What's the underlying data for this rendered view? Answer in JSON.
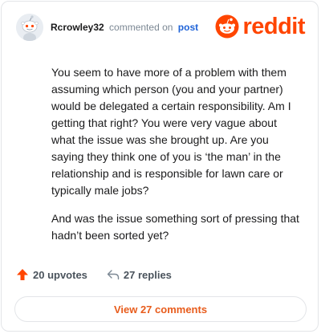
{
  "header": {
    "username": "Rcrowley32",
    "commented_text": "commented on",
    "post_link": "post",
    "brand": "reddit",
    "brand_color": "#ff4500"
  },
  "comment": {
    "paragraphs": [
      "You seem to have more of a problem with them assuming which person (you and your partner) would be delegated a certain responsibility. Am I getting that right? You were very vague about what the issue was she brought up. Are you saying they think one of you is ‘the man’ in the relationship and is responsible for lawn care or typically male jobs?",
      "And was the issue something sort of pressing that hadn’t been sorted yet?"
    ]
  },
  "actions": {
    "upvotes": "20 upvotes",
    "replies": "27 replies",
    "upvote_icon": "arrow-up-icon",
    "reply_icon": "reply-arrow-icon"
  },
  "footer": {
    "view_comments": "View 27 comments"
  }
}
